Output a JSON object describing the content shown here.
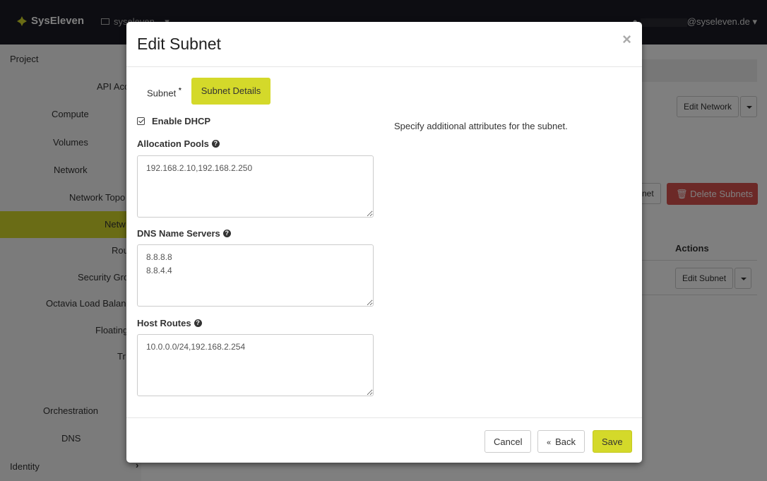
{
  "app": {
    "brand": "SysEleven",
    "project": "syseleven...",
    "user_suffix": "@syseleven.de"
  },
  "sidebar": {
    "items": [
      {
        "label": "Project"
      },
      {
        "label": "API Acc"
      },
      {
        "label": "Compute"
      },
      {
        "label": "Volumes"
      },
      {
        "label": "Network"
      },
      {
        "label": "Network Topo"
      },
      {
        "label": "Netw"
      },
      {
        "label": "Rou"
      },
      {
        "label": "Security Gro"
      },
      {
        "label": "Octavia Load Balan"
      },
      {
        "label": "Floating"
      },
      {
        "label": "Tr"
      },
      {
        "label": "Orchestration"
      },
      {
        "label": "DNS"
      },
      {
        "label": "Identity"
      }
    ]
  },
  "background": {
    "edit_network": "Edit Network",
    "create_subnet_partial": "net",
    "delete_subnets": "Delete Subnets",
    "actions_header": "Actions",
    "edit_subnet": "Edit Subnet"
  },
  "modal": {
    "title": "Edit Subnet",
    "close": "×",
    "tabs": [
      {
        "label": "Subnet",
        "required": "*"
      },
      {
        "label": "Subnet Details"
      }
    ],
    "enable_dhcp": "Enable DHCP",
    "allocation_pools_label": "Allocation Pools",
    "allocation_pools_value": "192.168.2.10,192.168.2.250",
    "dns_label": "DNS Name Servers",
    "dns_value": "8.8.8.8\n8.8.4.4",
    "host_routes_label": "Host Routes",
    "host_routes_value": "10.0.0.0/24,192.168.2.254",
    "description": "Specify additional attributes for the subnet.",
    "help": "?",
    "buttons": {
      "cancel": "Cancel",
      "back_chevron": "«",
      "back": "Back",
      "save": "Save"
    }
  },
  "colors": {
    "accent": "#d4d92a",
    "danger": "#d9534f",
    "topbar": "#1b1b24"
  }
}
